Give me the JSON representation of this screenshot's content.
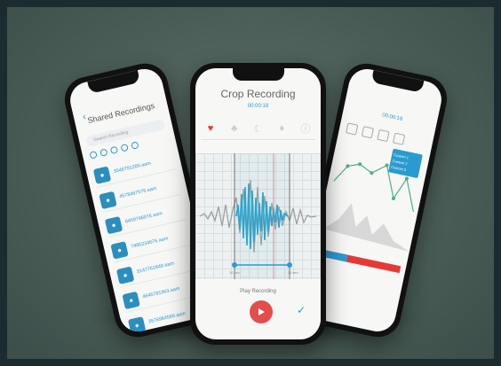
{
  "left_screen": {
    "title": "Shared Recordings",
    "search_placeholder": "Search Recording",
    "items": [
      {
        "number": "3546791285.aam"
      },
      {
        "number": "4578467576.aam"
      },
      {
        "number": "6459796976.aam"
      },
      {
        "number": "7495234676.aam"
      },
      {
        "number": "3147761849.aam"
      },
      {
        "number": "4645781963.aam"
      },
      {
        "number": "3576984589.aam"
      }
    ]
  },
  "center_screen": {
    "title": "Crop Recording",
    "time": "00:00:18",
    "play_label": "Play Recording",
    "marker_left": "10 sec",
    "marker_right": "20 sec"
  },
  "right_screen": {
    "time": "00:00:18",
    "menu": [
      "Custom 1",
      "Custom 2",
      "Custom 3"
    ]
  },
  "colors": {
    "accent": "#2a9bd1",
    "record": "#e54c4c"
  }
}
